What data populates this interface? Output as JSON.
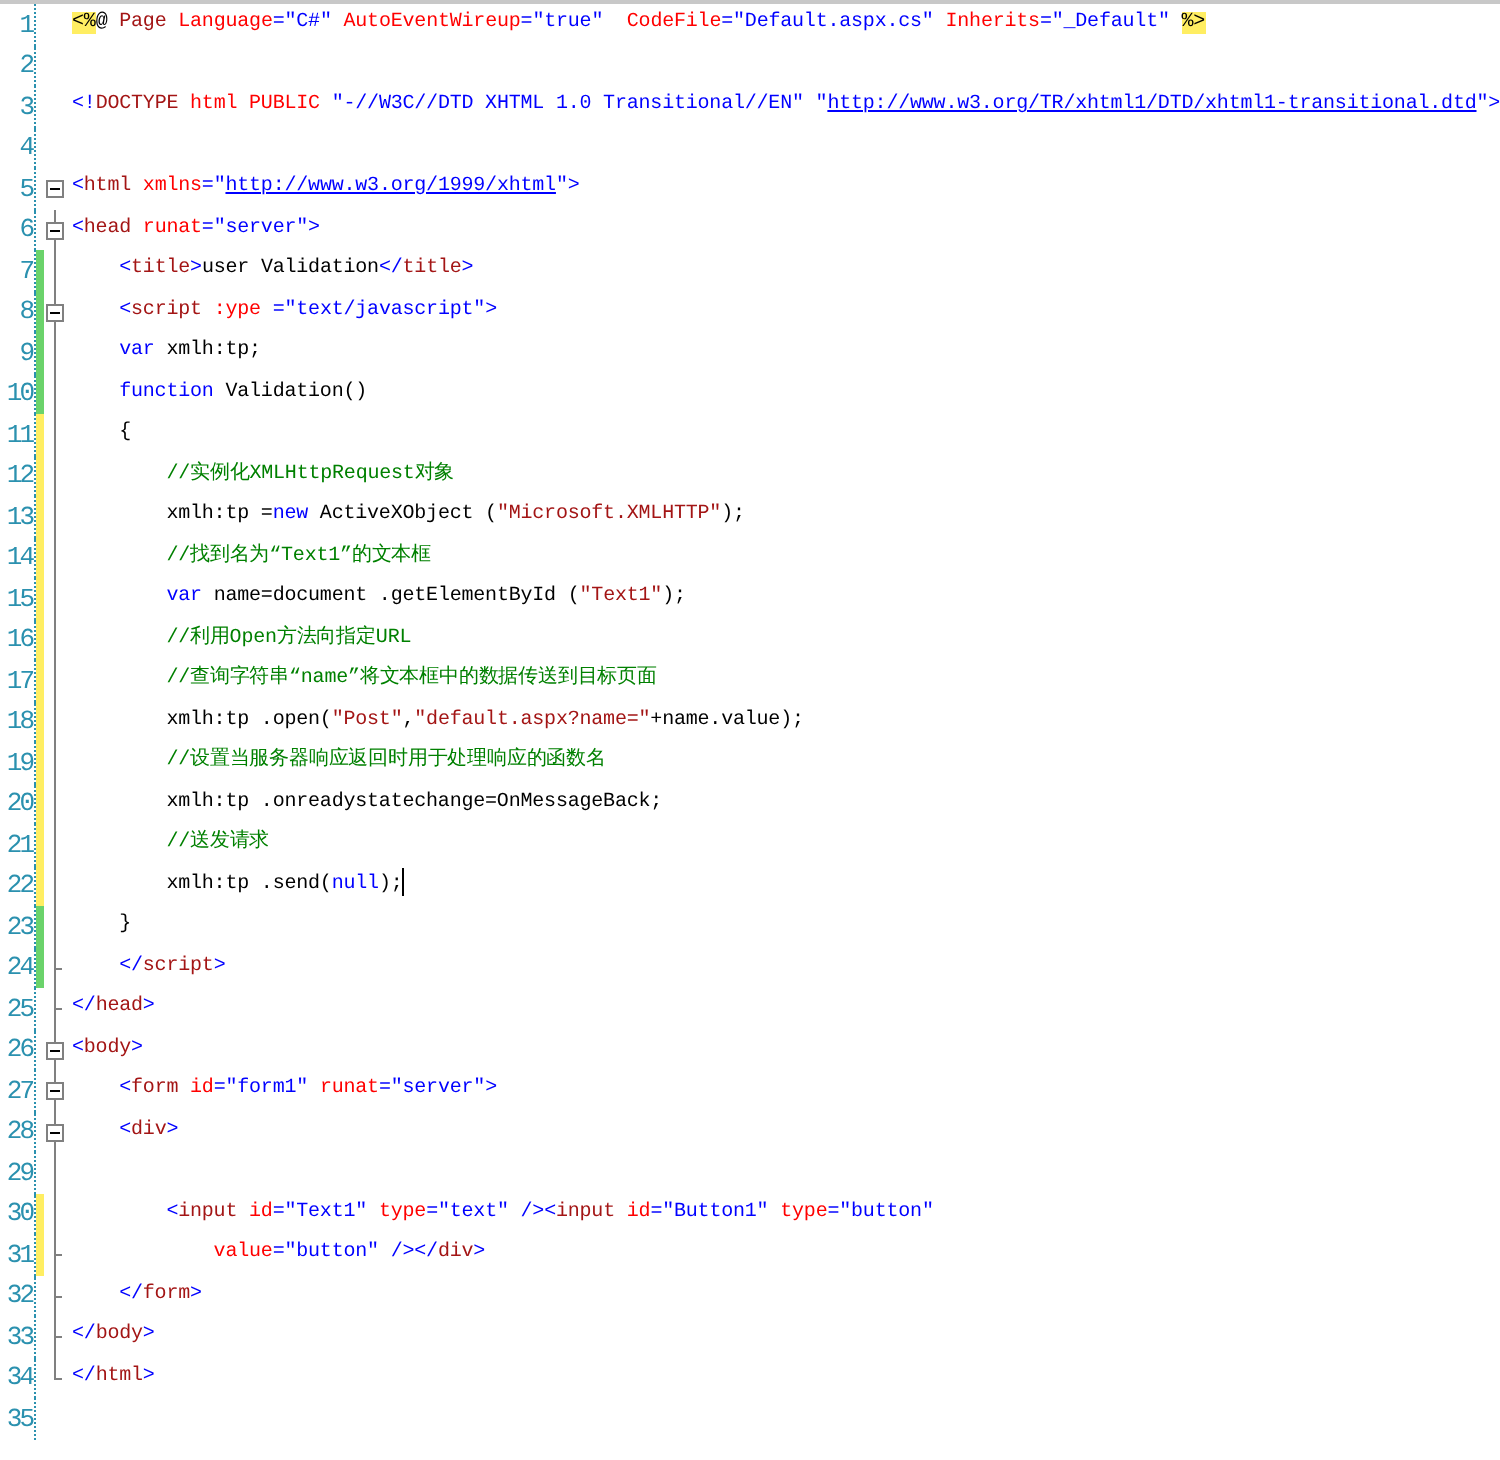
{
  "lines": [
    {
      "number": "1",
      "changed": false,
      "collapsible": false,
      "fold_end": false,
      "tokens": [
        {
          "kind": "directive",
          "text": "<%"
        },
        {
          "kind": "text",
          "text": "@ "
        },
        {
          "kind": "element",
          "text": "Page"
        },
        {
          "kind": "attribute",
          "text": " Language"
        },
        {
          "kind": "punct",
          "text": "="
        },
        {
          "kind": "value",
          "text": "\"C#\""
        },
        {
          "kind": "attribute",
          "text": " AutoEventWireup"
        },
        {
          "kind": "punct",
          "text": "="
        },
        {
          "kind": "value",
          "text": "\"true\""
        },
        {
          "kind": "attribute",
          "text": "  CodeFile"
        },
        {
          "kind": "punct",
          "text": "="
        },
        {
          "kind": "value",
          "text": "\"Default.aspx.cs\""
        },
        {
          "kind": "attribute",
          "text": " Inherits"
        },
        {
          "kind": "punct",
          "text": "="
        },
        {
          "kind": "value",
          "text": "\"_Default\" "
        },
        {
          "kind": "directive",
          "text": "%>"
        }
      ]
    },
    {
      "number": "2",
      "changed": false,
      "collapsible": false,
      "fold_end": false
    },
    {
      "number": "3",
      "changed": false,
      "collapsible": false,
      "fold_end": false,
      "tokens": [
        {
          "kind": "punct",
          "text": "<!"
        },
        {
          "kind": "element",
          "text": "DOCTYPE"
        },
        {
          "kind": "attribute",
          "text": " html PUBLIC"
        },
        {
          "kind": "value",
          "text": " \"-//W3C//DTD XHTML 1.0 Transitional//EN\" \""
        },
        {
          "kind": "link",
          "text": "http://www.w3.org/TR/xhtml1/DTD/xhtml1-transitional.dtd"
        },
        {
          "kind": "punct",
          "text": "\">"
        }
      ]
    },
    {
      "number": "4",
      "changed": false,
      "collapsible": false,
      "fold_end": false
    },
    {
      "number": "5",
      "changed": false,
      "collapsible": true,
      "tokens": [
        {
          "kind": "punct",
          "text": "<"
        },
        {
          "kind": "element",
          "text": "html"
        },
        {
          "kind": "attribute",
          "text": " xmlns"
        },
        {
          "kind": "punct",
          "text": "=\""
        },
        {
          "kind": "link",
          "text": "http://www.w3.org/1999/xhtml"
        },
        {
          "kind": "punct",
          "text": "\">"
        }
      ]
    },
    {
      "number": "6",
      "changed": false,
      "collapsible": true,
      "tokens": [
        {
          "kind": "punct",
          "text": "<"
        },
        {
          "kind": "element",
          "text": "head"
        },
        {
          "kind": "attribute",
          "text": " runat"
        },
        {
          "kind": "value",
          "text": "=\"server\""
        },
        {
          "kind": "punct",
          "text": ">"
        }
      ]
    },
    {
      "number": "7",
      "changed": true,
      "saved": true,
      "collapsible": false,
      "fold_end": false,
      "tokens": [
        {
          "kind": "punct",
          "text": "    <"
        },
        {
          "kind": "element",
          "text": "title"
        },
        {
          "kind": "punct",
          "text": ">"
        },
        {
          "kind": "text",
          "text": "user Validation"
        },
        {
          "kind": "punct",
          "text": "</"
        },
        {
          "kind": "element",
          "text": "title"
        },
        {
          "kind": "punct",
          "text": ">"
        }
      ]
    },
    {
      "number": "8",
      "changed": true,
      "saved": true,
      "collapsible": true,
      "tokens": [
        {
          "kind": "punct",
          "text": "    <"
        },
        {
          "kind": "element",
          "text": "script"
        },
        {
          "kind": "attribute",
          "text": " :ype"
        },
        {
          "kind": "value",
          "text": " =\"text/javascript\""
        },
        {
          "kind": "punct",
          "text": ">"
        }
      ]
    },
    {
      "number": "9",
      "changed": true,
      "saved": true,
      "collapsible": false,
      "fold_end": false,
      "tokens": [
        {
          "kind": "keyword",
          "text": "    var"
        },
        {
          "kind": "text",
          "text": " xmlh:tp;"
        }
      ]
    },
    {
      "number": "10",
      "changed": true,
      "saved": true,
      "collapsible": false,
      "fold_end": false,
      "tokens": [
        {
          "kind": "keyword",
          "text": "    function"
        },
        {
          "kind": "text",
          "text": " Validation()"
        }
      ]
    },
    {
      "number": "11",
      "changed": true,
      "saved": false,
      "collapsible": false,
      "fold_end": false,
      "tokens": [
        {
          "kind": "text",
          "text": "    {"
        }
      ]
    },
    {
      "number": "12",
      "changed": true,
      "saved": false,
      "collapsible": false,
      "fold_end": false,
      "tokens": [
        {
          "kind": "comment",
          "text": "        //实例化XMLHttpRequest对象"
        }
      ]
    },
    {
      "number": "13",
      "changed": true,
      "saved": false,
      "collapsible": false,
      "fold_end": false,
      "tokens": [
        {
          "kind": "text",
          "text": "        xmlh:tp ="
        },
        {
          "kind": "keyword",
          "text": "new"
        },
        {
          "kind": "text",
          "text": " ActiveXObject ("
        },
        {
          "kind": "string",
          "text": "\"Microsoft.XMLHTTP\""
        },
        {
          "kind": "text",
          "text": ");"
        }
      ]
    },
    {
      "number": "14",
      "changed": true,
      "saved": false,
      "collapsible": false,
      "fold_end": false,
      "tokens": [
        {
          "kind": "comment",
          "text": "        //找到名为“Text1”的文本框"
        }
      ]
    },
    {
      "number": "15",
      "changed": true,
      "saved": false,
      "collapsible": false,
      "fold_end": false,
      "tokens": [
        {
          "kind": "keyword",
          "text": "        var"
        },
        {
          "kind": "text",
          "text": " name=document .getElementById ("
        },
        {
          "kind": "string",
          "text": "\"Text1\""
        },
        {
          "kind": "text",
          "text": ");"
        }
      ]
    },
    {
      "number": "16",
      "changed": true,
      "saved": false,
      "collapsible": false,
      "fold_end": false,
      "tokens": [
        {
          "kind": "comment",
          "text": "        //利用Open方法向指定URL"
        }
      ]
    },
    {
      "number": "17",
      "changed": true,
      "saved": false,
      "collapsible": false,
      "fold_end": false,
      "tokens": [
        {
          "kind": "comment",
          "text": "        //查询字符串“name”将文本框中的数据传送到目标页面"
        }
      ]
    },
    {
      "number": "18",
      "changed": true,
      "saved": false,
      "collapsible": false,
      "fold_end": false,
      "tokens": [
        {
          "kind": "text",
          "text": "        xmlh:tp .open("
        },
        {
          "kind": "string",
          "text": "\"Post\""
        },
        {
          "kind": "text",
          "text": ","
        },
        {
          "kind": "string",
          "text": "\"default.aspx?name=\""
        },
        {
          "kind": "text",
          "text": "+name.value);"
        }
      ]
    },
    {
      "number": "19",
      "changed": true,
      "saved": false,
      "collapsible": false,
      "fold_end": false,
      "tokens": [
        {
          "kind": "comment",
          "text": "        //设置当服务器响应返回时用于处理响应的函数名"
        }
      ]
    },
    {
      "number": "20",
      "changed": true,
      "saved": false,
      "collapsible": false,
      "fold_end": false,
      "tokens": [
        {
          "kind": "text",
          "text": "        xmlh:tp .onreadystatechange=OnMessageBack;"
        }
      ]
    },
    {
      "number": "21",
      "changed": true,
      "saved": false,
      "collapsible": false,
      "fold_end": false,
      "tokens": [
        {
          "kind": "comment",
          "text": "        //送发请求"
        }
      ]
    },
    {
      "number": "22",
      "changed": true,
      "saved": false,
      "collapsible": false,
      "fold_end": false,
      "caret": true,
      "tokens": [
        {
          "kind": "text",
          "text": "        xmlh:tp .send("
        },
        {
          "kind": "keyword",
          "text": "null"
        },
        {
          "kind": "text",
          "text": ");"
        }
      ]
    },
    {
      "number": "23",
      "changed": true,
      "saved": true,
      "collapsible": false,
      "fold_end": false,
      "tokens": [
        {
          "kind": "text",
          "text": "    }"
        }
      ]
    },
    {
      "number": "24",
      "changed": true,
      "saved": true,
      "collapsible": false,
      "fold_end": true,
      "tokens": [
        {
          "kind": "punct",
          "text": "    </"
        },
        {
          "kind": "element",
          "text": "script"
        },
        {
          "kind": "punct",
          "text": ">"
        }
      ]
    },
    {
      "number": "25",
      "changed": false,
      "collapsible": false,
      "fold_end": true,
      "tokens": [
        {
          "kind": "punct",
          "text": "</"
        },
        {
          "kind": "element",
          "text": "head"
        },
        {
          "kind": "punct",
          "text": ">"
        }
      ]
    },
    {
      "number": "26",
      "changed": false,
      "collapsible": true,
      "tokens": [
        {
          "kind": "punct",
          "text": "<"
        },
        {
          "kind": "element",
          "text": "body"
        },
        {
          "kind": "punct",
          "text": ">"
        }
      ]
    },
    {
      "number": "27",
      "changed": false,
      "collapsible": true,
      "tokens": [
        {
          "kind": "punct",
          "text": "    <"
        },
        {
          "kind": "element",
          "text": "form"
        },
        {
          "kind": "attribute",
          "text": " id"
        },
        {
          "kind": "value",
          "text": "=\"form1\""
        },
        {
          "kind": "attribute",
          "text": " runat"
        },
        {
          "kind": "value",
          "text": "=\"server\""
        },
        {
          "kind": "punct",
          "text": ">"
        }
      ]
    },
    {
      "number": "28",
      "changed": false,
      "collapsible": true,
      "tokens": [
        {
          "kind": "punct",
          "text": "    <"
        },
        {
          "kind": "element",
          "text": "div"
        },
        {
          "kind": "punct",
          "text": ">"
        }
      ]
    },
    {
      "number": "29",
      "changed": false,
      "collapsible": false,
      "fold_end": false
    },
    {
      "number": "30",
      "changed": true,
      "saved": false,
      "collapsible": false,
      "fold_end": false,
      "tokens": [
        {
          "kind": "punct",
          "text": "        <"
        },
        {
          "kind": "element",
          "text": "input"
        },
        {
          "kind": "attribute",
          "text": " id"
        },
        {
          "kind": "value",
          "text": "=\"Text1\""
        },
        {
          "kind": "attribute",
          "text": " type"
        },
        {
          "kind": "value",
          "text": "=\"text\""
        },
        {
          "kind": "punct",
          "text": " /><"
        },
        {
          "kind": "element",
          "text": "input"
        },
        {
          "kind": "attribute",
          "text": " id"
        },
        {
          "kind": "value",
          "text": "=\"Button1\""
        },
        {
          "kind": "attribute",
          "text": " type"
        },
        {
          "kind": "value",
          "text": "=\"button\""
        }
      ]
    },
    {
      "number": "31",
      "changed": true,
      "saved": false,
      "collapsible": false,
      "fold_end": true,
      "tokens": [
        {
          "kind": "attribute",
          "text": "            value"
        },
        {
          "kind": "value",
          "text": "=\"button\""
        },
        {
          "kind": "punct",
          "text": " /></"
        },
        {
          "kind": "element",
          "text": "div"
        },
        {
          "kind": "punct",
          "text": ">"
        }
      ]
    },
    {
      "number": "32",
      "changed": false,
      "collapsible": false,
      "fold_end": true,
      "tokens": [
        {
          "kind": "punct",
          "text": "    </"
        },
        {
          "kind": "element",
          "text": "form"
        },
        {
          "kind": "punct",
          "text": ">"
        }
      ]
    },
    {
      "number": "33",
      "changed": false,
      "collapsible": false,
      "fold_end": true,
      "tokens": [
        {
          "kind": "punct",
          "text": "</"
        },
        {
          "kind": "element",
          "text": "body"
        },
        {
          "kind": "punct",
          "text": ">"
        }
      ]
    },
    {
      "number": "34",
      "changed": false,
      "collapsible": false,
      "fold_end": true,
      "tokens": [
        {
          "kind": "punct",
          "text": "</"
        },
        {
          "kind": "element",
          "text": "html"
        },
        {
          "kind": "punct",
          "text": ">"
        }
      ]
    },
    {
      "number": "35",
      "changed": false,
      "collapsible": false,
      "fold_end": false
    }
  ]
}
